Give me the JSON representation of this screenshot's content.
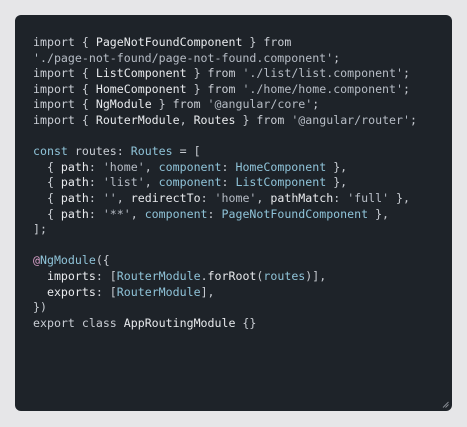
{
  "editor": {
    "theme_background": "#1e2329",
    "page_background": "#e6e6e8",
    "lines": [
      [
        {
          "t": "kw",
          "v": "import "
        },
        {
          "t": "punc",
          "v": "{ "
        },
        {
          "t": "name",
          "v": "PageNotFoundComponent"
        },
        {
          "t": "punc",
          "v": " } "
        },
        {
          "t": "kw",
          "v": "from"
        }
      ],
      [
        {
          "t": "str",
          "v": "'./page-not-found/page-not-found.component'"
        },
        {
          "t": "punc",
          "v": ";"
        }
      ],
      [
        {
          "t": "kw",
          "v": "import "
        },
        {
          "t": "punc",
          "v": "{ "
        },
        {
          "t": "name",
          "v": "ListComponent"
        },
        {
          "t": "punc",
          "v": " } "
        },
        {
          "t": "kw",
          "v": "from "
        },
        {
          "t": "str",
          "v": "'./list/list.component'"
        },
        {
          "t": "punc",
          "v": ";"
        }
      ],
      [
        {
          "t": "kw",
          "v": "import "
        },
        {
          "t": "punc",
          "v": "{ "
        },
        {
          "t": "name",
          "v": "HomeComponent"
        },
        {
          "t": "punc",
          "v": " } "
        },
        {
          "t": "kw",
          "v": "from "
        },
        {
          "t": "str",
          "v": "'./home/home.component'"
        },
        {
          "t": "punc",
          "v": ";"
        }
      ],
      [
        {
          "t": "kw",
          "v": "import "
        },
        {
          "t": "punc",
          "v": "{ "
        },
        {
          "t": "name",
          "v": "NgModule"
        },
        {
          "t": "punc",
          "v": " } "
        },
        {
          "t": "kw",
          "v": "from "
        },
        {
          "t": "str",
          "v": "'@angular/core'"
        },
        {
          "t": "punc",
          "v": ";"
        }
      ],
      [
        {
          "t": "kw",
          "v": "import "
        },
        {
          "t": "punc",
          "v": "{ "
        },
        {
          "t": "name",
          "v": "RouterModule"
        },
        {
          "t": "punc",
          "v": ", "
        },
        {
          "t": "name",
          "v": "Routes"
        },
        {
          "t": "punc",
          "v": " } "
        },
        {
          "t": "kw",
          "v": "from "
        },
        {
          "t": "str",
          "v": "'@angular/router'"
        },
        {
          "t": "punc",
          "v": ";"
        }
      ],
      [],
      [
        {
          "t": "type",
          "v": "const "
        },
        {
          "t": "kw",
          "v": "routes"
        },
        {
          "t": "punc",
          "v": ": "
        },
        {
          "t": "type",
          "v": "Routes"
        },
        {
          "t": "punc",
          "v": " = ["
        }
      ],
      [
        {
          "t": "punc",
          "v": "  { "
        },
        {
          "t": "prop",
          "v": "path"
        },
        {
          "t": "punc",
          "v": ": "
        },
        {
          "t": "str",
          "v": "'home'"
        },
        {
          "t": "punc",
          "v": ", "
        },
        {
          "t": "type",
          "v": "component"
        },
        {
          "t": "punc",
          "v": ": "
        },
        {
          "t": "type",
          "v": "HomeComponent"
        },
        {
          "t": "punc",
          "v": " },"
        }
      ],
      [
        {
          "t": "punc",
          "v": "  { "
        },
        {
          "t": "prop",
          "v": "path"
        },
        {
          "t": "punc",
          "v": ": "
        },
        {
          "t": "str",
          "v": "'list'"
        },
        {
          "t": "punc",
          "v": ", "
        },
        {
          "t": "type",
          "v": "component"
        },
        {
          "t": "punc",
          "v": ": "
        },
        {
          "t": "type",
          "v": "ListComponent"
        },
        {
          "t": "punc",
          "v": " },"
        }
      ],
      [
        {
          "t": "punc",
          "v": "  { "
        },
        {
          "t": "prop",
          "v": "path"
        },
        {
          "t": "punc",
          "v": ": "
        },
        {
          "t": "str",
          "v": "''"
        },
        {
          "t": "punc",
          "v": ", "
        },
        {
          "t": "prop",
          "v": "redirectTo"
        },
        {
          "t": "punc",
          "v": ": "
        },
        {
          "t": "str",
          "v": "'home'"
        },
        {
          "t": "punc",
          "v": ", "
        },
        {
          "t": "prop",
          "v": "pathMatch"
        },
        {
          "t": "punc",
          "v": ": "
        },
        {
          "t": "str",
          "v": "'full'"
        },
        {
          "t": "punc",
          "v": " },"
        }
      ],
      [
        {
          "t": "punc",
          "v": "  { "
        },
        {
          "t": "prop",
          "v": "path"
        },
        {
          "t": "punc",
          "v": ": "
        },
        {
          "t": "str",
          "v": "'**'"
        },
        {
          "t": "punc",
          "v": ", "
        },
        {
          "t": "type",
          "v": "component"
        },
        {
          "t": "punc",
          "v": ": "
        },
        {
          "t": "type",
          "v": "PageNotFoundComponent"
        },
        {
          "t": "punc",
          "v": " },"
        }
      ],
      [
        {
          "t": "punc",
          "v": "];"
        }
      ],
      [],
      [
        {
          "t": "deco",
          "v": "@"
        },
        {
          "t": "type",
          "v": "NgModule"
        },
        {
          "t": "punc",
          "v": "({"
        }
      ],
      [
        {
          "t": "punc",
          "v": "  "
        },
        {
          "t": "prop",
          "v": "imports"
        },
        {
          "t": "punc",
          "v": ": ["
        },
        {
          "t": "type",
          "v": "RouterModule"
        },
        {
          "t": "punc",
          "v": "."
        },
        {
          "t": "name",
          "v": "forRoot"
        },
        {
          "t": "punc",
          "v": "("
        },
        {
          "t": "type",
          "v": "routes"
        },
        {
          "t": "punc",
          "v": ")],"
        }
      ],
      [
        {
          "t": "punc",
          "v": "  "
        },
        {
          "t": "prop",
          "v": "exports"
        },
        {
          "t": "punc",
          "v": ": ["
        },
        {
          "t": "type",
          "v": "RouterModule"
        },
        {
          "t": "punc",
          "v": "],"
        }
      ],
      [
        {
          "t": "punc",
          "v": "})"
        }
      ],
      [
        {
          "t": "kw",
          "v": "export "
        },
        {
          "t": "kw",
          "v": "class "
        },
        {
          "t": "name",
          "v": "AppRoutingModule"
        },
        {
          "t": "punc",
          "v": " {}"
        }
      ]
    ]
  },
  "icons": {
    "resize": "resize-grip-icon"
  }
}
